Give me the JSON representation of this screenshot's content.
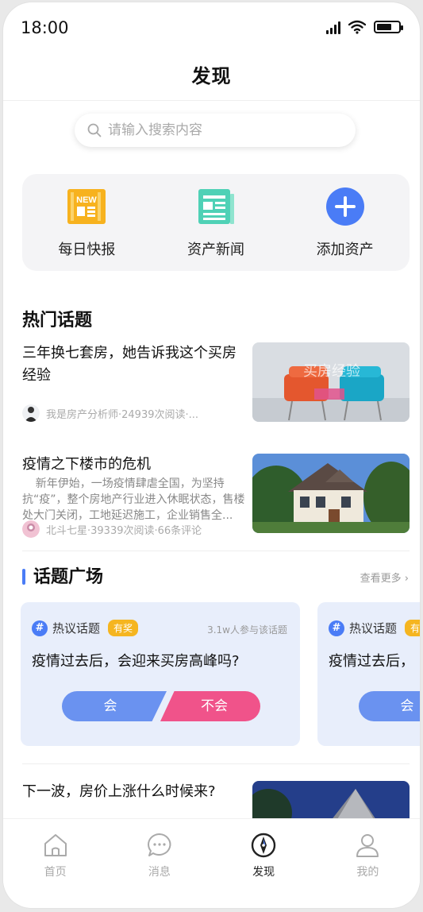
{
  "status": {
    "time": "18:00"
  },
  "nav": {
    "title": "发现"
  },
  "search": {
    "placeholder": "请输入搜索内容"
  },
  "quick_actions": [
    {
      "label": "每日快报",
      "icon": "newspaper-new-icon",
      "badge": "NEW",
      "color": "#f7b21e"
    },
    {
      "label": "资产新闻",
      "icon": "news-document-icon",
      "color": "#4fd1b6"
    },
    {
      "label": "添加资产",
      "icon": "plus-circle-icon",
      "color": "#4a7cf6"
    }
  ],
  "hot_topics": {
    "title": "热门话题",
    "articles": [
      {
        "title": "三年换七套房，她告诉我这个买房经验",
        "meta": "我是房产分析师·24939次阅读·...",
        "thumb_text": "买房经验"
      },
      {
        "title": "疫情之下楼市的危机",
        "summary": "新年伊始，一场疫情肆虐全国，为坚持抗“疫”，整个房地产行业进入休眠状态，售楼处大门关闭，工地延迟施工，企业销售全...",
        "meta": "北斗七星·39339次阅读·66条评论"
      },
      {
        "title": "下一波，房价上涨什么时候来?"
      }
    ]
  },
  "plaza": {
    "title": "话题广场",
    "more": "查看更多",
    "cards": [
      {
        "tag": "热议话题",
        "prize": "有奖",
        "count": "3.1w人参与该话题",
        "question": "疫情过去后，会迎来买房高峰吗?",
        "yes": "会",
        "no": "不会"
      },
      {
        "tag": "热议话题",
        "prize": "有",
        "question": "疫情过去后，",
        "yes": "会"
      }
    ]
  },
  "tabs": [
    {
      "label": "首页",
      "icon": "home-icon"
    },
    {
      "label": "消息",
      "icon": "message-icon"
    },
    {
      "label": "发现",
      "icon": "compass-icon",
      "active": true
    },
    {
      "label": "我的",
      "icon": "user-icon"
    }
  ],
  "colors": {
    "accent": "#4a7cf6",
    "no_vote": "#f0538a",
    "card_bg": "#e8eefb"
  }
}
